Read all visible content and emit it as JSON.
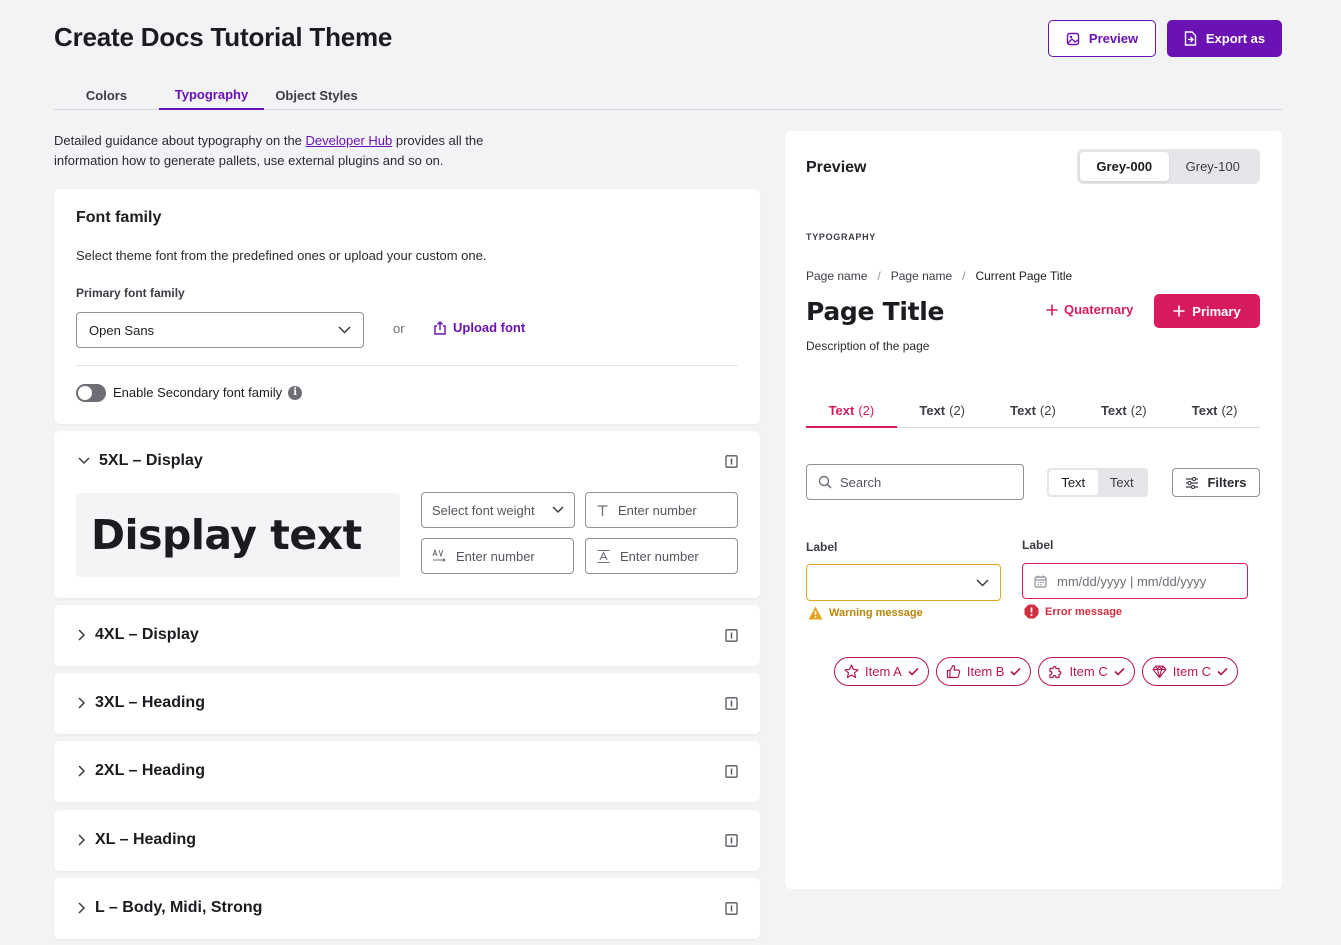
{
  "header": {
    "title": "Create Docs Tutorial Theme",
    "preview_label": "Preview",
    "export_label": "Export as"
  },
  "tabs": [
    {
      "label": "Colors"
    },
    {
      "label": "Typography"
    },
    {
      "label": "Object Styles"
    }
  ],
  "intro": {
    "before_link": "Detailed guidance about typography on the ",
    "link": "Developer Hub",
    "after_link": " provides all the information how to generate pallets, use external plugins and so on."
  },
  "font_family": {
    "title": "Font family",
    "description": "Select theme font from the predefined ones or upload your custom one.",
    "primary_label": "Primary font family",
    "primary_value": "Open Sans",
    "or_text": "or",
    "upload_label": "Upload font",
    "secondary_toggle_label": "Enable Secondary font family",
    "info_glyph": "i"
  },
  "sections": [
    {
      "label": "5XL – Display",
      "expanded": true
    },
    {
      "label": "4XL – Display"
    },
    {
      "label": "3XL – Heading"
    },
    {
      "label": "2XL – Heading"
    },
    {
      "label": "XL – Heading"
    },
    {
      "label": "L – Body, Midi, Strong"
    }
  ],
  "display_section": {
    "sample_text": "Display text",
    "weight_placeholder": "Select font weight",
    "size_placeholder": "Enter number",
    "letter_spacing_placeholder": "Enter number",
    "line_height_placeholder": "Enter number"
  },
  "preview": {
    "title": "Preview",
    "bg_options": [
      "Grey-000",
      "Grey-100"
    ],
    "typography_label": "TYPOGRAPHY",
    "breadcrumb": [
      "Page name",
      "Page name",
      "Current Page Title"
    ],
    "breadcrumb_sep": "/",
    "page_title": "Page Title",
    "page_description": "Description of the page",
    "quaternary_label": "Quaternary",
    "primary_label": "Primary",
    "tabs": [
      {
        "label": "Text",
        "count": "(2)"
      },
      {
        "label": "Text",
        "count": "(2)"
      },
      {
        "label": "Text",
        "count": "(2)"
      },
      {
        "label": "Text",
        "count": "(2)"
      },
      {
        "label": "Text",
        "count": "(2)"
      }
    ],
    "search_placeholder": "Search",
    "toggle": [
      "Text",
      "Text"
    ],
    "filters_label": "Filters",
    "field1_label": "Label",
    "field2_label": "Label",
    "date_placeholder": "mm/dd/yyyy | mm/dd/yyyy",
    "warning_message": "Warning message",
    "error_message": "Error message",
    "chips": [
      {
        "label": "Item A",
        "icon": "star-icon"
      },
      {
        "label": "Item B",
        "icon": "thumbs-up-icon"
      },
      {
        "label": "Item C",
        "icon": "puzzle-icon"
      },
      {
        "label": "Item C",
        "icon": "diamond-icon"
      }
    ]
  },
  "colors": {
    "brand_purple": "#6a12b3",
    "accent_pink": "#d81b5e",
    "warning": "#e2a51f",
    "error": "#d12f3f"
  }
}
